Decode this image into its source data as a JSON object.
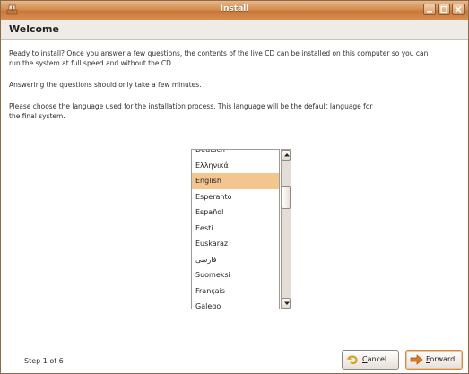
{
  "window": {
    "title": "Install",
    "controls": [
      "minimize",
      "maximize",
      "close"
    ]
  },
  "page": {
    "heading": "Welcome",
    "paragraphs": [
      "Ready to install? Once you answer a few questions, the contents of the live CD can be installed on this computer so you can run the system at full speed and without the CD.",
      "Answering the questions should only take a few minutes.",
      "Please choose the language used for the installation process. This language will be the default language for the final system."
    ]
  },
  "languages": {
    "items": [
      "Deutsch",
      "Ελληνικά",
      "English",
      "Esperanto",
      "Español",
      "Eesti",
      "Euskaraz",
      "فارسی",
      "Suomeksi",
      "Français",
      "Galego"
    ],
    "selected": "English"
  },
  "footer": {
    "step": "Step 1 of 6",
    "cancel_label": "Cancel",
    "cancel_mnemonic": "C",
    "cancel_rest": "ancel",
    "forward_label": "Forward",
    "forward_mnemonic": "F",
    "forward_rest": "orward"
  },
  "colors": {
    "titlebar": "#d48d4e",
    "selection": "#f4c68f",
    "accent": "#e07a1f"
  }
}
